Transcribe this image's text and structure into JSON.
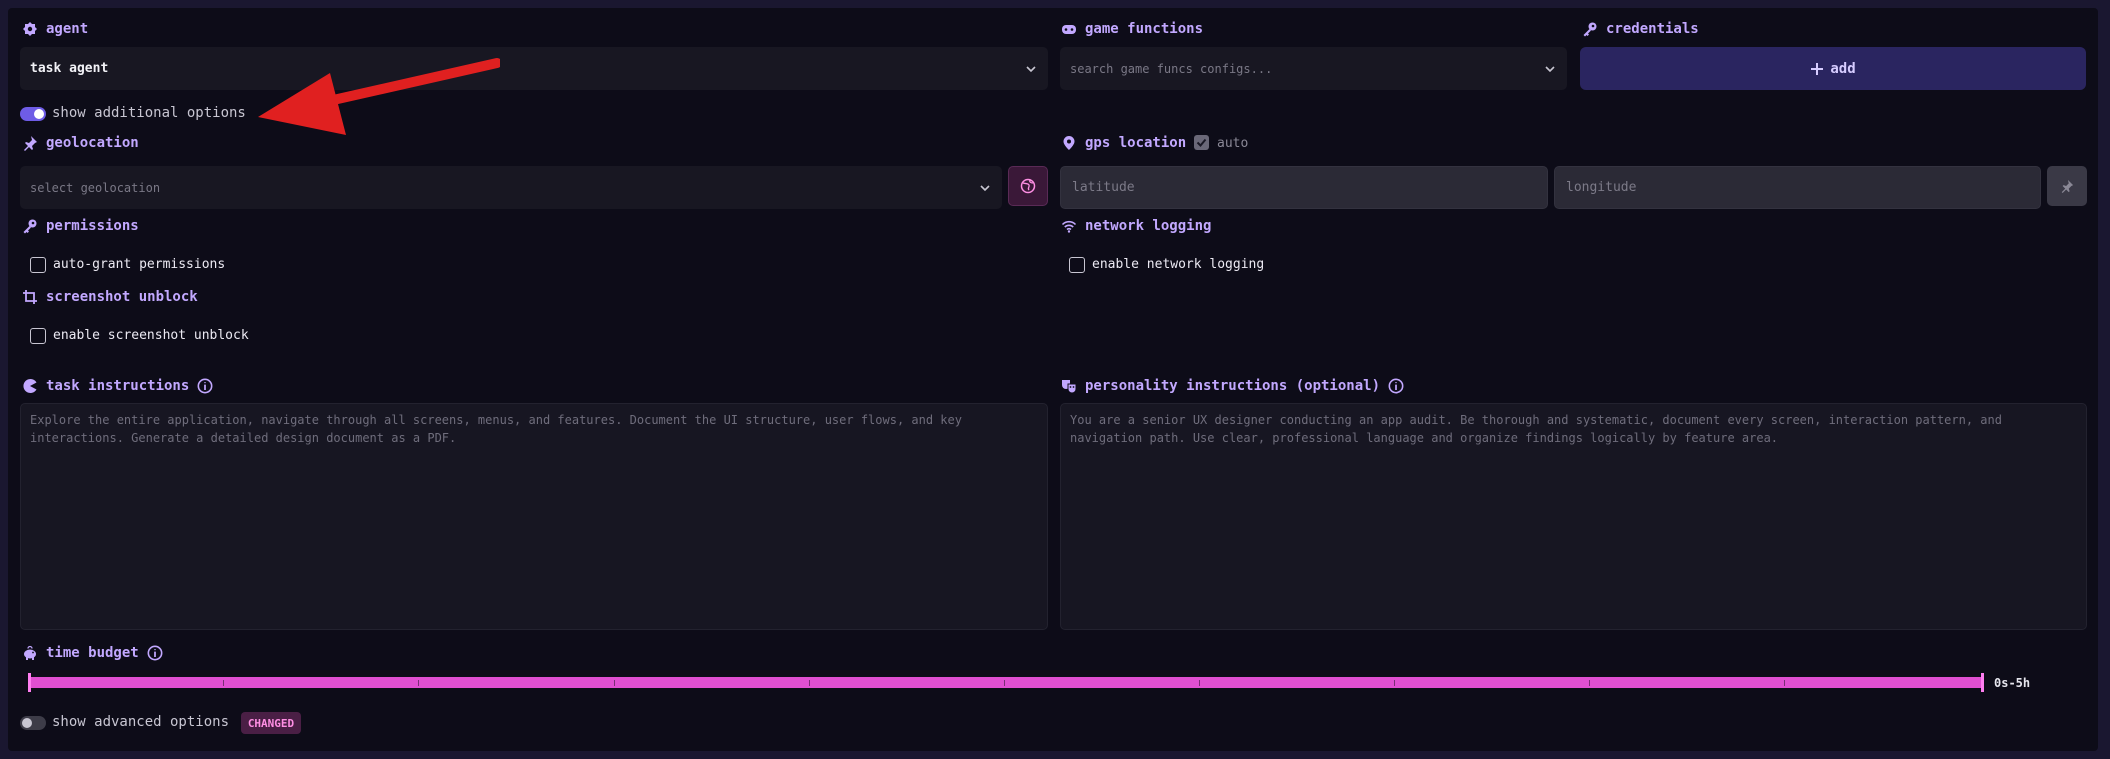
{
  "agent": {
    "label": "agent",
    "selected": "task agent"
  },
  "game_functions": {
    "label": "game functions",
    "placeholder": "search game funcs configs..."
  },
  "credentials": {
    "label": "credentials",
    "add_label": "add"
  },
  "additional_toggle": {
    "label": "show additional options",
    "on": true
  },
  "geolocation": {
    "label": "geolocation",
    "placeholder": "select geolocation"
  },
  "gps": {
    "label": "gps location",
    "auto_label": "auto",
    "auto_checked": true,
    "latitude_placeholder": "latitude",
    "longitude_placeholder": "longitude"
  },
  "permissions": {
    "label": "permissions",
    "checkbox_label": "auto-grant permissions",
    "checked": false
  },
  "network_logging": {
    "label": "network logging",
    "checkbox_label": "enable network logging",
    "checked": false
  },
  "screenshot_unblock": {
    "label": "screenshot unblock",
    "checkbox_label": "enable screenshot unblock",
    "checked": false
  },
  "task_instructions": {
    "label": "task instructions",
    "placeholder": "Explore the entire application, navigate through all screens, menus, and features. Document the UI structure, user flows, and key interactions. Generate a detailed design document as a PDF."
  },
  "personality_instructions": {
    "label": "personality instructions (optional)",
    "placeholder": "You are a senior UX designer conducting an app audit. Be thorough and systematic, document every screen, interaction pattern, and navigation path. Use clear, professional language and organize findings logically by feature area."
  },
  "time_budget": {
    "label": "time budget",
    "range_label": "0s-5h",
    "min_fraction": 0.0,
    "max_fraction": 1.0
  },
  "advanced_toggle": {
    "label": "show advanced options",
    "on": false,
    "badge": "CHANGED"
  },
  "colors": {
    "accent": "#c2a8ff",
    "toggle_on": "#6e5ce6",
    "slider": "#e04fd1",
    "annotation_arrow": "#e02020"
  }
}
